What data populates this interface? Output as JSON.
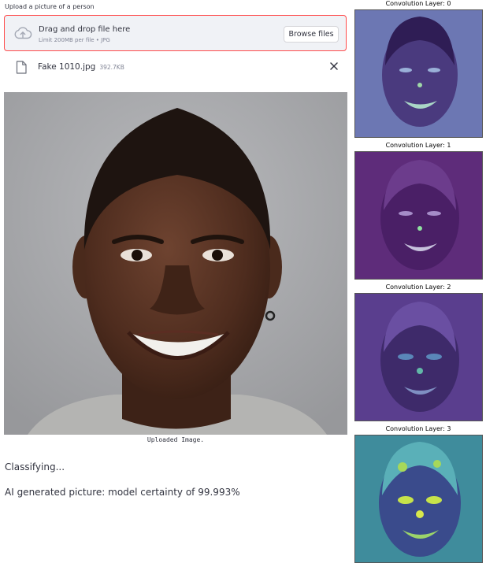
{
  "uploader": {
    "label": "Upload a picture of a person",
    "drop_title": "Drag and drop file here",
    "limit_text": "Limit 200MB per file • JPG",
    "browse_label": "Browse files"
  },
  "file": {
    "name": "Fake 1010.jpg",
    "size": "392.7KB"
  },
  "image_caption": "Uploaded Image.",
  "status_text": "Classifying...",
  "result_text": "AI generated picture: model certainty of 99.993%",
  "conv_layers": [
    {
      "title": "Convolution Layer: 0"
    },
    {
      "title": "Convolution Layer: 1"
    },
    {
      "title": "Convolution Layer: 2"
    },
    {
      "title": "Convolution Layer: 3"
    }
  ],
  "colors": {
    "accent": "#ff4b4b",
    "dropzone_bg": "#f0f2f6",
    "text": "#31333f",
    "muted": "#808495"
  }
}
